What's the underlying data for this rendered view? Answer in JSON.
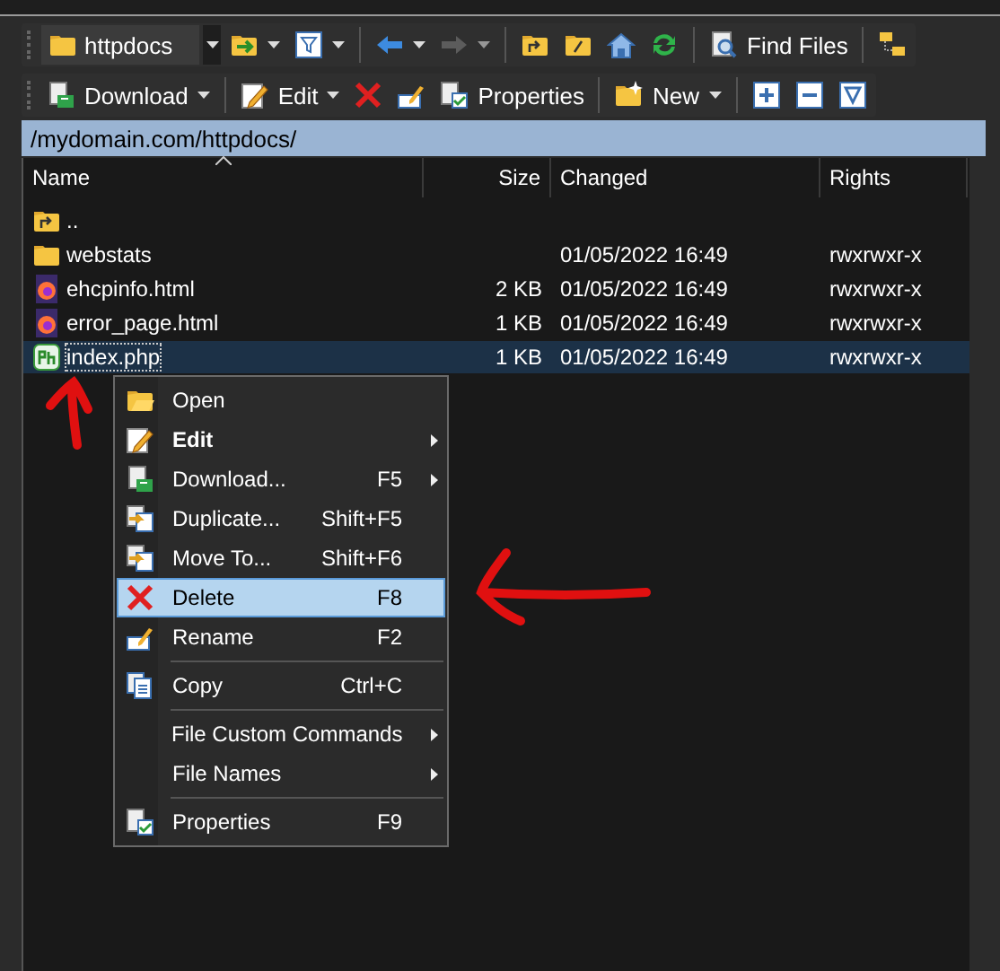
{
  "toolbars": [
    {
      "items": [
        {
          "kind": "combo",
          "value": "httpdocs"
        },
        {
          "kind": "button",
          "dropdown": true,
          "disabled": false
        },
        {
          "kind": "button",
          "dropdown": true,
          "disabled": false
        },
        {
          "kind": "separator"
        },
        {
          "kind": "button",
          "dropdown": true,
          "disabled": false
        },
        {
          "kind": "button",
          "dropdown": true,
          "disabled": true
        },
        {
          "kind": "separator"
        },
        {
          "kind": "button",
          "dropdown": false,
          "disabled": false
        },
        {
          "kind": "button",
          "dropdown": false,
          "disabled": false
        },
        {
          "kind": "button",
          "dropdown": false,
          "disabled": false
        },
        {
          "kind": "button",
          "dropdown": false,
          "disabled": false
        },
        {
          "kind": "separator"
        },
        {
          "kind": "button",
          "label": "Find Files",
          "dropdown": false,
          "disabled": false
        },
        {
          "kind": "separator"
        },
        {
          "kind": "button",
          "dropdown": false,
          "disabled": false
        }
      ]
    },
    {
      "items": [
        {
          "kind": "button",
          "label": "Download",
          "dropdown": true,
          "disabled": false
        },
        {
          "kind": "separator"
        },
        {
          "kind": "button",
          "label": "Edit",
          "dropdown": true,
          "disabled": false
        },
        {
          "kind": "button",
          "dropdown": false,
          "disabled": false
        },
        {
          "kind": "button",
          "dropdown": false,
          "disabled": false
        },
        {
          "kind": "button",
          "label": "Properties",
          "dropdown": false,
          "disabled": false
        },
        {
          "kind": "separator"
        },
        {
          "kind": "button",
          "label": "New",
          "dropdown": true,
          "disabled": false
        },
        {
          "kind": "separator"
        },
        {
          "kind": "button",
          "dropdown": false,
          "disabled": false
        },
        {
          "kind": "button",
          "dropdown": false,
          "disabled": false
        },
        {
          "kind": "button",
          "dropdown": false,
          "disabled": false
        }
      ]
    }
  ],
  "path": "/mydomain.com/httpdocs/",
  "columns": [
    {
      "label": "Name",
      "sorted": true
    },
    {
      "label": "Size",
      "sorted": false
    },
    {
      "label": "Changed",
      "sorted": false
    },
    {
      "label": "Rights",
      "sorted": false
    }
  ],
  "files": [
    {
      "kind": "parent",
      "name": "..",
      "selected": false
    },
    {
      "kind": "folder",
      "name": "webstats",
      "changed": "01/05/2022 16:49",
      "rights": "rwxrwxr-x",
      "selected": false
    },
    {
      "kind": "html",
      "name": "ehcpinfo.html",
      "size": "2 KB",
      "changed": "01/05/2022 16:49",
      "rights": "rwxrwxr-x",
      "selected": false
    },
    {
      "kind": "html",
      "name": "error_page.html",
      "size": "1 KB",
      "changed": "01/05/2022 16:49",
      "rights": "rwxrwxr-x",
      "selected": false
    },
    {
      "kind": "php",
      "name": "index.php",
      "size": "1 KB",
      "changed": "01/05/2022 16:49",
      "rights": "rwxrwxr-x",
      "selected": true
    }
  ],
  "context_menu": [
    {
      "kind": "item",
      "label": "Open",
      "bold": false,
      "submenu": false,
      "selected": false
    },
    {
      "kind": "item",
      "label": "Edit",
      "bold": true,
      "submenu": true,
      "selected": false
    },
    {
      "kind": "item",
      "label": "Download...",
      "shortcut": "F5",
      "bold": false,
      "submenu": true,
      "selected": false
    },
    {
      "kind": "item",
      "label": "Duplicate...",
      "shortcut": "Shift+F5",
      "bold": false,
      "submenu": false,
      "selected": false
    },
    {
      "kind": "item",
      "label": "Move To...",
      "shortcut": "Shift+F6",
      "bold": false,
      "submenu": false,
      "selected": false
    },
    {
      "kind": "item",
      "label": "Delete",
      "shortcut": "F8",
      "bold": false,
      "submenu": false,
      "selected": true
    },
    {
      "kind": "item",
      "label": "Rename",
      "shortcut": "F2",
      "bold": false,
      "submenu": false,
      "selected": false
    },
    {
      "kind": "separator"
    },
    {
      "kind": "item",
      "label": "Copy",
      "shortcut": "Ctrl+C",
      "bold": false,
      "submenu": false,
      "selected": false
    },
    {
      "kind": "separator"
    },
    {
      "kind": "item",
      "label": "File Custom Commands",
      "bold": false,
      "submenu": true,
      "selected": false
    },
    {
      "kind": "item",
      "label": "File Names",
      "bold": false,
      "submenu": true,
      "selected": false
    },
    {
      "kind": "separator"
    },
    {
      "kind": "item",
      "label": "Properties",
      "shortcut": "F9",
      "bold": false,
      "submenu": false,
      "selected": false
    }
  ]
}
